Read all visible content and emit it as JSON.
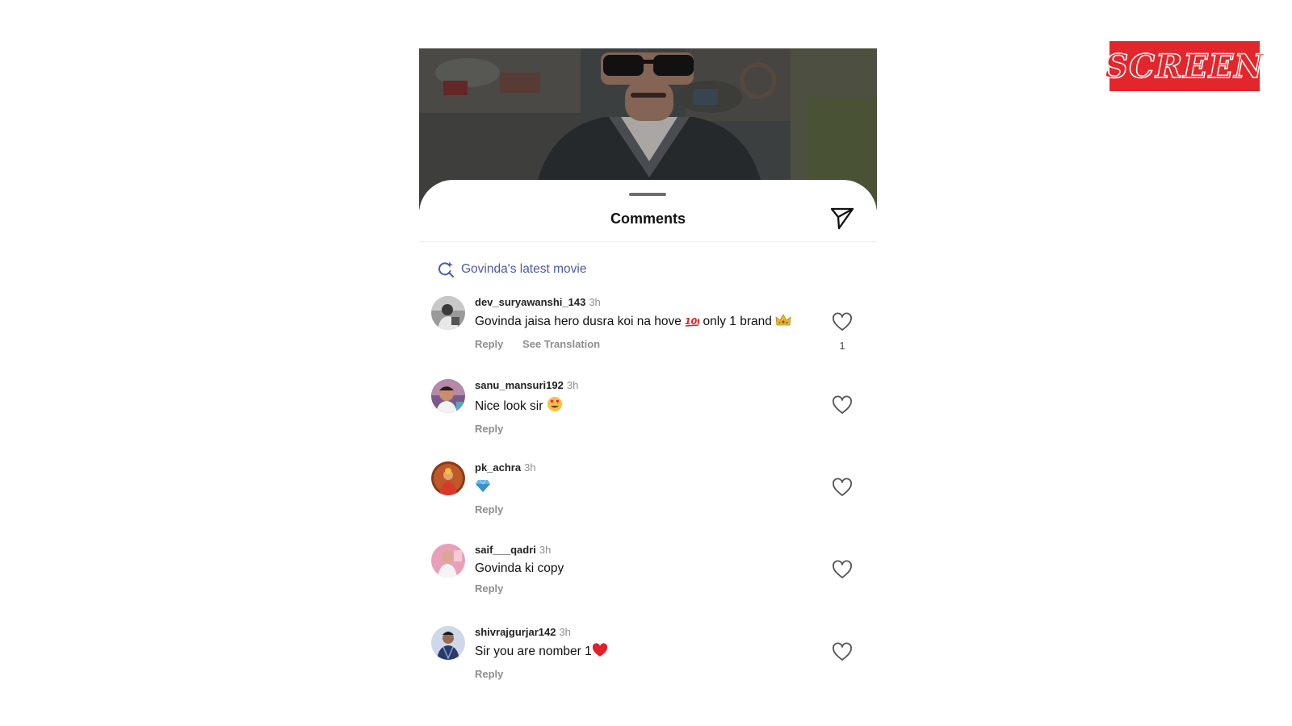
{
  "logo": {
    "text": "SCREEN",
    "color": "#e3262b"
  },
  "sheet": {
    "title": "Comments",
    "share_icon": "paper-plane-icon"
  },
  "suggestion": {
    "icon": "search-sparkle-icon",
    "text": "Govinda's latest movie",
    "color": "#4b5aa8"
  },
  "comments": [
    {
      "user": "dev_suryawanshi_143",
      "time": "3h",
      "text": "Govinda jaisa hero dusra koi na hove",
      "emoji_after": "100",
      "text2": "only 1 brand",
      "emoji_end": "crown",
      "reply": "Reply",
      "translate": "See Translation",
      "likes": "1"
    },
    {
      "user": "sanu_mansuri192",
      "time": "3h",
      "text": "Nice look sir",
      "emoji_end": "heart-eyes",
      "reply": "Reply"
    },
    {
      "user": "pk_achra",
      "time": "3h",
      "text": "",
      "emoji_end": "gem",
      "reply": "Reply"
    },
    {
      "user": "saif___qadri",
      "time": "3h",
      "text": "Govinda ki copy",
      "reply": "Reply"
    },
    {
      "user": "shivrajgurjar142",
      "time": "3h",
      "text": "Sir you are nomber 1",
      "emoji_end": "red-heart",
      "reply": "Reply"
    }
  ]
}
